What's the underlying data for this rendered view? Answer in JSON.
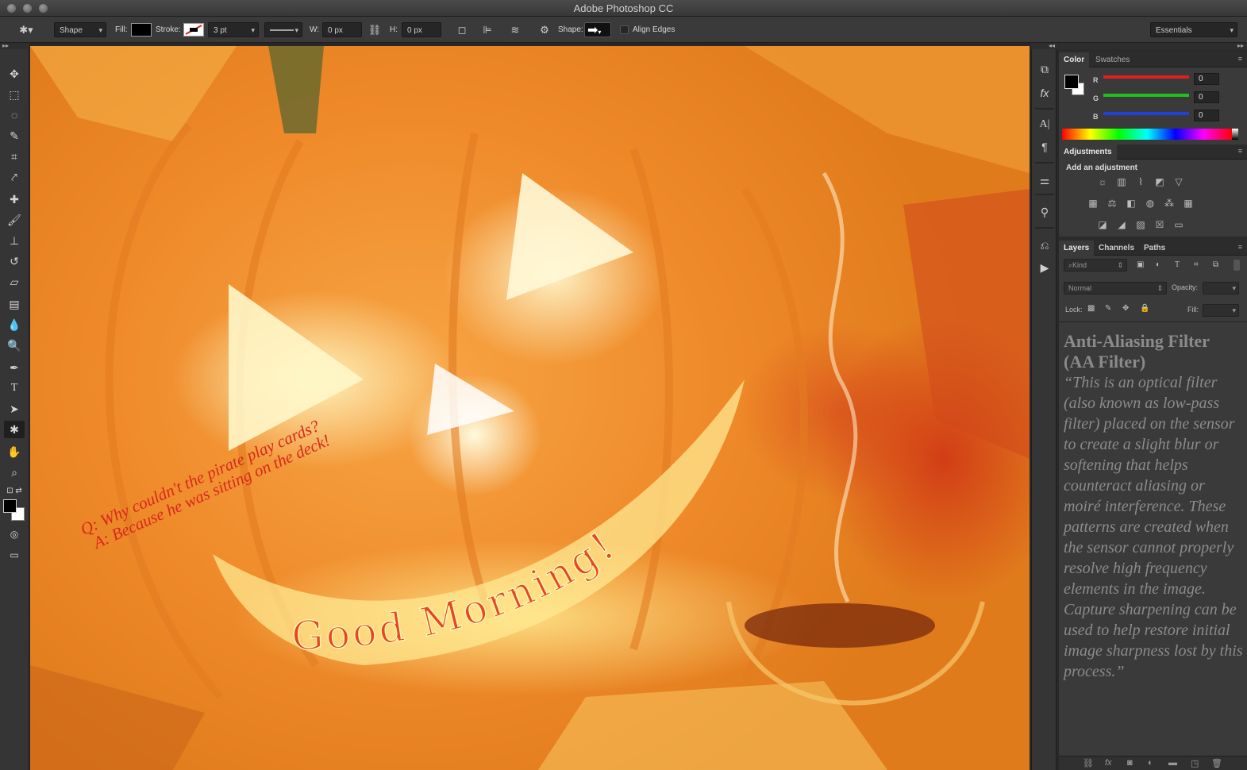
{
  "app": {
    "title": "Adobe Photoshop CC"
  },
  "options": {
    "mode": "Shape",
    "fill_label": "Fill:",
    "stroke_label": "Stroke:",
    "stroke_width": "3 pt",
    "w_label": "W:",
    "w_value": "0 px",
    "h_label": "H:",
    "h_value": "0 px",
    "shape_label": "Shape:",
    "align_edges": "Align Edges",
    "workspace": "Essentials"
  },
  "canvas": {
    "joke_line1": "Q: Why couldn't the pirate play cards?",
    "joke_line2": "A: Because he was sitting on the deck!",
    "greeting": "Good Morning!"
  },
  "color_panel": {
    "tabs": [
      "Color",
      "Swatches"
    ],
    "sliders": [
      {
        "label": "R",
        "value": "0",
        "color": "#e02020"
      },
      {
        "label": "G",
        "value": "0",
        "color": "#20c020"
      },
      {
        "label": "B",
        "value": "0",
        "color": "#2040e0"
      }
    ]
  },
  "adjustments_panel": {
    "tab": "Adjustments",
    "heading": "Add an adjustment"
  },
  "layers_panel": {
    "tabs": [
      "Layers",
      "Channels",
      "Paths"
    ],
    "filter": "Kind",
    "blend_mode": "Normal",
    "opacity_label": "Opacity:",
    "lock_label": "Lock:",
    "fill_label": "Fill:"
  },
  "annotation": {
    "title": "Anti-Aliasing Filter (AA Filter)",
    "body": "“This is an optical filter (also known as low-pass filter) placed on the sensor to create a slight blur or softening that helps counteract aliasing or moiré interference. These patterns are created when the sensor cannot properly resolve high frequency elements in the image. Capture sharpening can be used to help restore initial image sharpness lost by this process.”"
  },
  "colors": {
    "accent_red": "#e02020",
    "text_red": "#d7281c",
    "panel_bg": "#3a3a3a"
  }
}
